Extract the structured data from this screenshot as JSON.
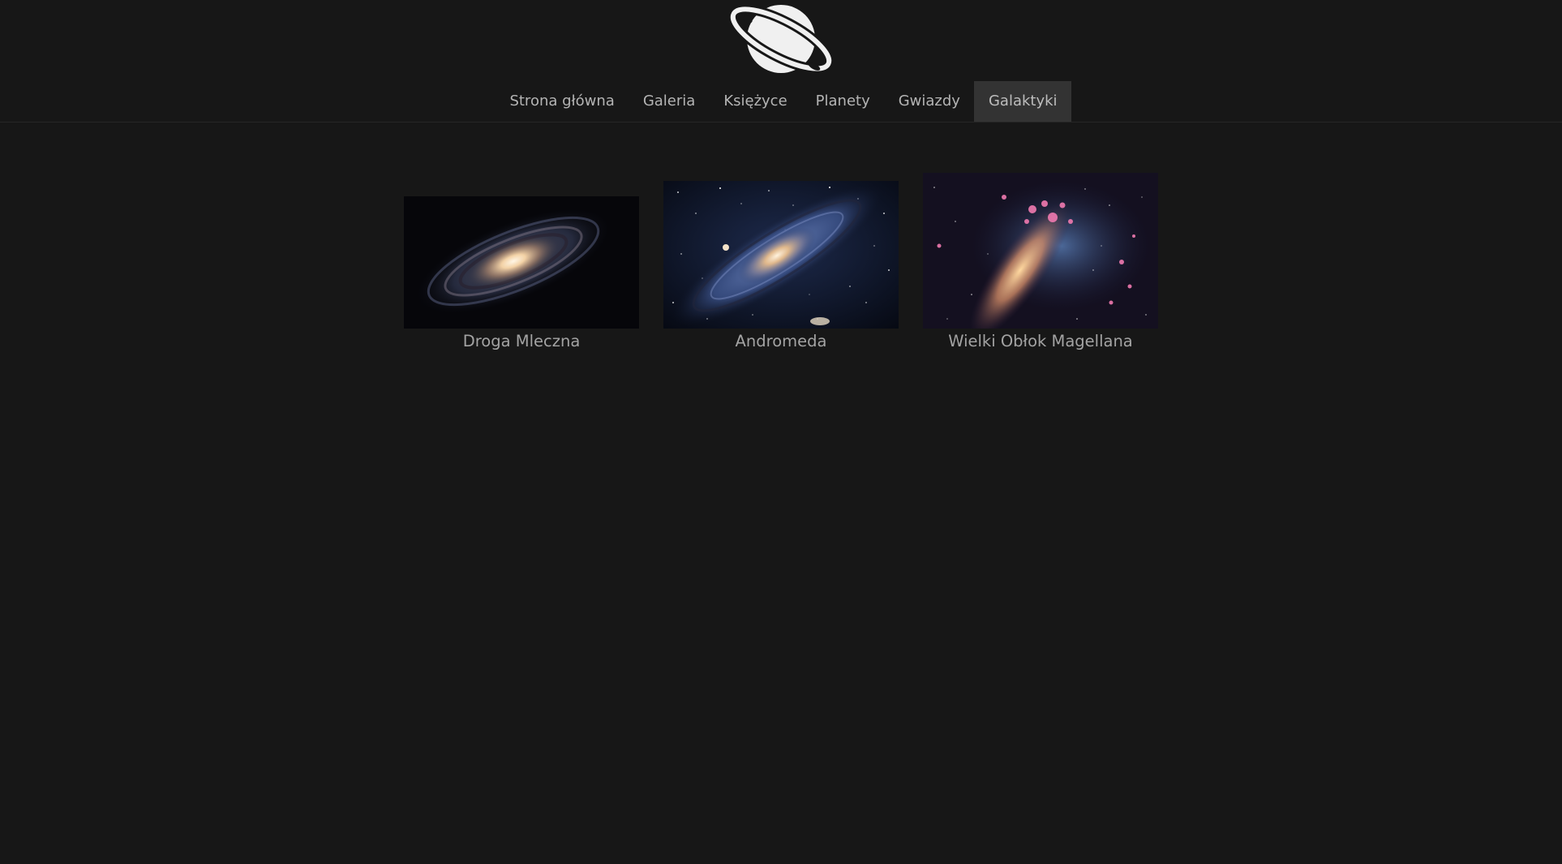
{
  "nav": {
    "items": [
      {
        "label": "Strona główna",
        "active": false
      },
      {
        "label": "Galeria",
        "active": false
      },
      {
        "label": "Księżyce",
        "active": false
      },
      {
        "label": "Planety",
        "active": false
      },
      {
        "label": "Gwiazdy",
        "active": false
      },
      {
        "label": "Galaktyki",
        "active": true
      }
    ]
  },
  "logo": {
    "icon": "saturn-planet-icon",
    "color": "#f0f0f0"
  },
  "gallery": {
    "items": [
      {
        "caption": "Droga Mleczna",
        "image": "milky-way-galaxy-image"
      },
      {
        "caption": "Andromeda",
        "image": "andromeda-galaxy-image"
      },
      {
        "caption": "Wielki Obłok Magellana",
        "image": "large-magellanic-cloud-image"
      }
    ]
  },
  "colors": {
    "background": "#171717",
    "nav_active_bg": "#333333",
    "nav_text": "#b4b4b4",
    "caption_text": "#a3a3a3"
  }
}
